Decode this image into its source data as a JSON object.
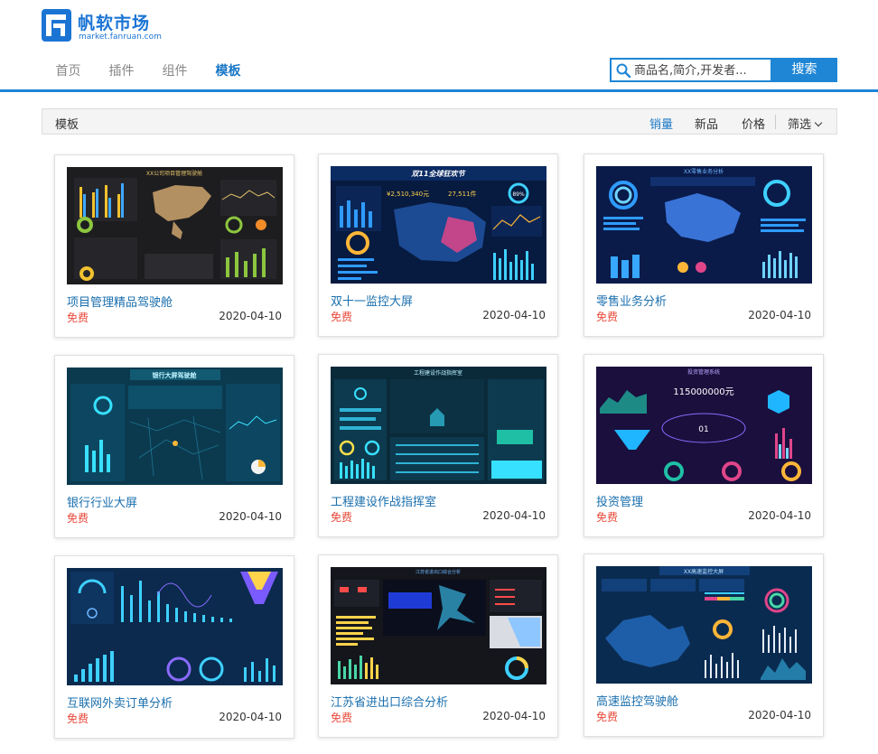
{
  "brand": {
    "name": "帆软市场",
    "domain": "market.fanruan.com",
    "color": "#1b74d4"
  },
  "nav": {
    "items": [
      {
        "label": "首页",
        "active": false
      },
      {
        "label": "插件",
        "active": false
      },
      {
        "label": "组件",
        "active": false
      },
      {
        "label": "模板",
        "active": true
      }
    ]
  },
  "search": {
    "placeholder": "商品名,简介,开发者...",
    "button_label": "搜索",
    "icon": "search-icon"
  },
  "filter": {
    "title": "模板",
    "sorts": [
      {
        "label": "销量",
        "active": true
      },
      {
        "label": "新品",
        "active": false
      },
      {
        "label": "价格",
        "active": false
      }
    ],
    "filter_label": "筛选"
  },
  "templates": [
    {
      "title": "项目管理精品驾驶舱",
      "price": "免费",
      "date": "2020-04-10",
      "thumb_headline": "XX公司项目管理驾驶舱"
    },
    {
      "title": "双十一监控大屏",
      "price": "免费",
      "date": "2020-04-10",
      "thumb_headline": "双11全球狂欢节",
      "thumb_values": [
        "¥2,510,340元",
        "27,511件",
        "89%"
      ]
    },
    {
      "title": "零售业务分析",
      "price": "免费",
      "date": "2020-04-10",
      "thumb_headline": "XX零售业务分析"
    },
    {
      "title": "银行行业大屏",
      "price": "免费",
      "date": "2020-04-10",
      "thumb_headline": "银行大屏驾驶舱"
    },
    {
      "title": "工程建设作战指挥室",
      "price": "免费",
      "date": "2020-04-10",
      "thumb_headline": "工程建设作战指挥室"
    },
    {
      "title": "投资管理",
      "price": "免费",
      "date": "2020-04-10",
      "thumb_headline": "投资管理系统",
      "thumb_values": [
        "115000000元",
        "01"
      ]
    },
    {
      "title": "互联网外卖订单分析",
      "price": "免费",
      "date": "2020-04-10",
      "thumb_headline": ""
    },
    {
      "title": "江苏省进出口综合分析",
      "price": "免费",
      "date": "2020-04-10",
      "thumb_headline": "江苏省进出口综合分析"
    },
    {
      "title": "高速监控驾驶舱",
      "price": "免费",
      "date": "2020-04-10",
      "thumb_headline": "XX高速监控大屏"
    }
  ],
  "colors": {
    "accent": "#1f86d6",
    "price": "#e8493a",
    "link": "#1a6fae"
  }
}
